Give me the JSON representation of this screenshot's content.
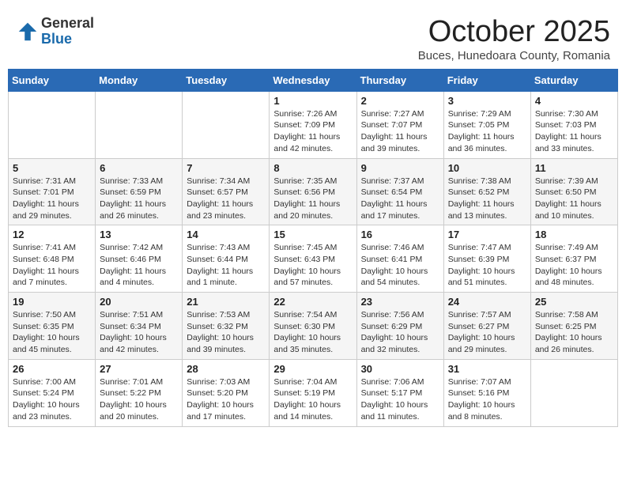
{
  "header": {
    "logo_general": "General",
    "logo_blue": "Blue",
    "month_title": "October 2025",
    "location": "Buces, Hunedoara County, Romania"
  },
  "weekdays": [
    "Sunday",
    "Monday",
    "Tuesday",
    "Wednesday",
    "Thursday",
    "Friday",
    "Saturday"
  ],
  "weeks": [
    [
      {
        "day": "",
        "info": ""
      },
      {
        "day": "",
        "info": ""
      },
      {
        "day": "",
        "info": ""
      },
      {
        "day": "1",
        "info": "Sunrise: 7:26 AM\nSunset: 7:09 PM\nDaylight: 11 hours\nand 42 minutes."
      },
      {
        "day": "2",
        "info": "Sunrise: 7:27 AM\nSunset: 7:07 PM\nDaylight: 11 hours\nand 39 minutes."
      },
      {
        "day": "3",
        "info": "Sunrise: 7:29 AM\nSunset: 7:05 PM\nDaylight: 11 hours\nand 36 minutes."
      },
      {
        "day": "4",
        "info": "Sunrise: 7:30 AM\nSunset: 7:03 PM\nDaylight: 11 hours\nand 33 minutes."
      }
    ],
    [
      {
        "day": "5",
        "info": "Sunrise: 7:31 AM\nSunset: 7:01 PM\nDaylight: 11 hours\nand 29 minutes."
      },
      {
        "day": "6",
        "info": "Sunrise: 7:33 AM\nSunset: 6:59 PM\nDaylight: 11 hours\nand 26 minutes."
      },
      {
        "day": "7",
        "info": "Sunrise: 7:34 AM\nSunset: 6:57 PM\nDaylight: 11 hours\nand 23 minutes."
      },
      {
        "day": "8",
        "info": "Sunrise: 7:35 AM\nSunset: 6:56 PM\nDaylight: 11 hours\nand 20 minutes."
      },
      {
        "day": "9",
        "info": "Sunrise: 7:37 AM\nSunset: 6:54 PM\nDaylight: 11 hours\nand 17 minutes."
      },
      {
        "day": "10",
        "info": "Sunrise: 7:38 AM\nSunset: 6:52 PM\nDaylight: 11 hours\nand 13 minutes."
      },
      {
        "day": "11",
        "info": "Sunrise: 7:39 AM\nSunset: 6:50 PM\nDaylight: 11 hours\nand 10 minutes."
      }
    ],
    [
      {
        "day": "12",
        "info": "Sunrise: 7:41 AM\nSunset: 6:48 PM\nDaylight: 11 hours\nand 7 minutes."
      },
      {
        "day": "13",
        "info": "Sunrise: 7:42 AM\nSunset: 6:46 PM\nDaylight: 11 hours\nand 4 minutes."
      },
      {
        "day": "14",
        "info": "Sunrise: 7:43 AM\nSunset: 6:44 PM\nDaylight: 11 hours\nand 1 minute."
      },
      {
        "day": "15",
        "info": "Sunrise: 7:45 AM\nSunset: 6:43 PM\nDaylight: 10 hours\nand 57 minutes."
      },
      {
        "day": "16",
        "info": "Sunrise: 7:46 AM\nSunset: 6:41 PM\nDaylight: 10 hours\nand 54 minutes."
      },
      {
        "day": "17",
        "info": "Sunrise: 7:47 AM\nSunset: 6:39 PM\nDaylight: 10 hours\nand 51 minutes."
      },
      {
        "day": "18",
        "info": "Sunrise: 7:49 AM\nSunset: 6:37 PM\nDaylight: 10 hours\nand 48 minutes."
      }
    ],
    [
      {
        "day": "19",
        "info": "Sunrise: 7:50 AM\nSunset: 6:35 PM\nDaylight: 10 hours\nand 45 minutes."
      },
      {
        "day": "20",
        "info": "Sunrise: 7:51 AM\nSunset: 6:34 PM\nDaylight: 10 hours\nand 42 minutes."
      },
      {
        "day": "21",
        "info": "Sunrise: 7:53 AM\nSunset: 6:32 PM\nDaylight: 10 hours\nand 39 minutes."
      },
      {
        "day": "22",
        "info": "Sunrise: 7:54 AM\nSunset: 6:30 PM\nDaylight: 10 hours\nand 35 minutes."
      },
      {
        "day": "23",
        "info": "Sunrise: 7:56 AM\nSunset: 6:29 PM\nDaylight: 10 hours\nand 32 minutes."
      },
      {
        "day": "24",
        "info": "Sunrise: 7:57 AM\nSunset: 6:27 PM\nDaylight: 10 hours\nand 29 minutes."
      },
      {
        "day": "25",
        "info": "Sunrise: 7:58 AM\nSunset: 6:25 PM\nDaylight: 10 hours\nand 26 minutes."
      }
    ],
    [
      {
        "day": "26",
        "info": "Sunrise: 7:00 AM\nSunset: 5:24 PM\nDaylight: 10 hours\nand 23 minutes."
      },
      {
        "day": "27",
        "info": "Sunrise: 7:01 AM\nSunset: 5:22 PM\nDaylight: 10 hours\nand 20 minutes."
      },
      {
        "day": "28",
        "info": "Sunrise: 7:03 AM\nSunset: 5:20 PM\nDaylight: 10 hours\nand 17 minutes."
      },
      {
        "day": "29",
        "info": "Sunrise: 7:04 AM\nSunset: 5:19 PM\nDaylight: 10 hours\nand 14 minutes."
      },
      {
        "day": "30",
        "info": "Sunrise: 7:06 AM\nSunset: 5:17 PM\nDaylight: 10 hours\nand 11 minutes."
      },
      {
        "day": "31",
        "info": "Sunrise: 7:07 AM\nSunset: 5:16 PM\nDaylight: 10 hours\nand 8 minutes."
      },
      {
        "day": "",
        "info": ""
      }
    ]
  ]
}
